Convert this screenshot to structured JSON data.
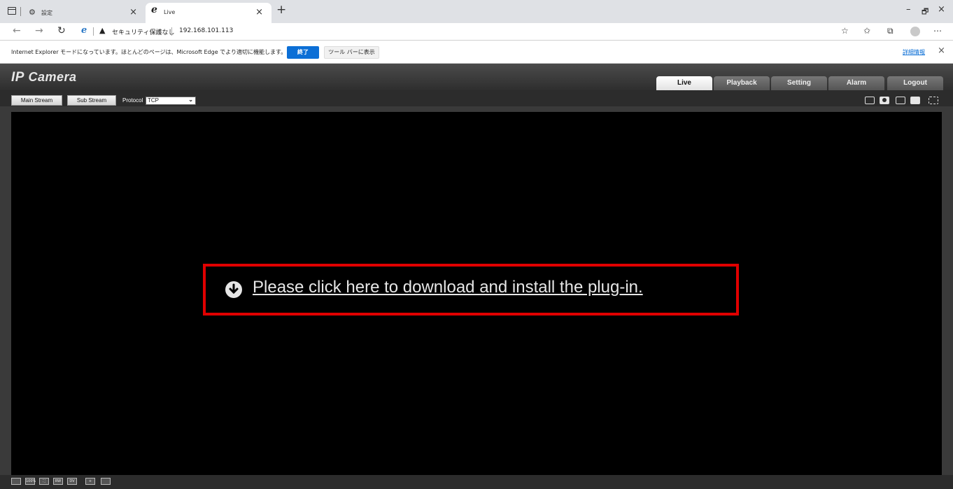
{
  "browser": {
    "tabs": [
      {
        "label": "設定",
        "icon": "gear-icon",
        "close": "×"
      },
      {
        "label": "Live",
        "icon": "ie-icon",
        "close": "×"
      }
    ],
    "new_tab": "+",
    "window_controls": {
      "minimize": "–",
      "restore": "🗗",
      "close": "×"
    },
    "address": {
      "warning_icon": "▲",
      "warning_text": "セキュリティ保護なし",
      "url": "192.168.101.113"
    }
  },
  "ie_bar": {
    "message": "Internet Explorer モードになっています。ほとんどのページは、Microsoft Edge でより適切に機能します。",
    "exit_label": "終了",
    "toolbar_label": "ツール バーに表示",
    "details_label": "詳細情報",
    "close": "×"
  },
  "app": {
    "brand_ip": "IP",
    "brand_camera": " Camera",
    "tabs": [
      "Live",
      "Playback",
      "Setting",
      "Alarm",
      "Logout"
    ],
    "active_tab": "Live",
    "main_stream": "Main Stream",
    "sub_stream": "Sub Stream",
    "protocol_label": "Protocol",
    "protocol_value": "TCP",
    "plugin_message": "Please click here to download and install the plug-in.",
    "bottom_icons": [
      "100%",
      "⛶",
      "RW",
      "DV",
      "+"
    ]
  },
  "colors": {
    "header": "#3a3a3a",
    "video_bg": "#000000",
    "highlight_box": "#e00000",
    "edge_blue": "#0c6fd6"
  }
}
